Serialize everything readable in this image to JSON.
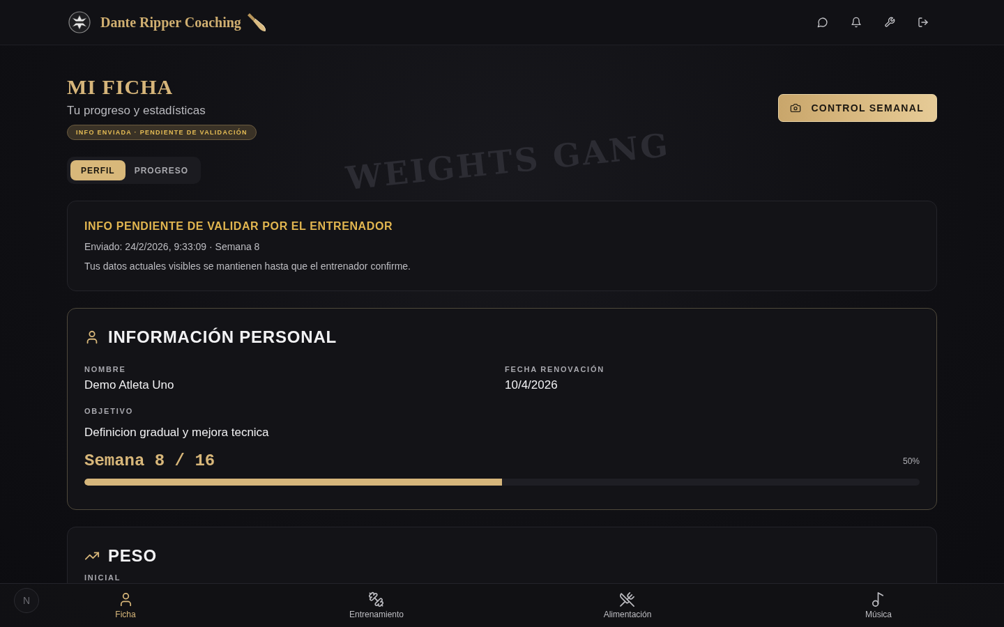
{
  "header": {
    "brand": "Dante Ripper Coaching"
  },
  "backdrop": {
    "text": "WEIGHTS GANG"
  },
  "page": {
    "title": "MI FICHA",
    "subtitle": "Tu progreso y estadísticas",
    "status_badge": "INFO ENVIADA · PENDIENTE DE VALIDACIÓN",
    "action_button": "CONTROL SEMANAL"
  },
  "tabs": [
    {
      "label": "PERFIL",
      "selected": true
    },
    {
      "label": "PROGRESO",
      "selected": false
    }
  ],
  "notice": {
    "title": "INFO PENDIENTE DE VALIDAR POR EL ENTRENADOR",
    "sent": "Enviado: 24/2/2026, 9:33:09 · Semana 8",
    "message": "Tus datos actuales visibles se mantienen hasta que el entrenador confirme."
  },
  "personal": {
    "title": "INFORMACIÓN PERSONAL",
    "fields": [
      {
        "label": "NOMBRE",
        "value": "Demo Atleta Uno"
      },
      {
        "label": "FECHA RENOVACIÓN",
        "value": "10/4/2026"
      }
    ],
    "goal": {
      "label": "OBJETIVO",
      "value": "Definicion gradual y mejora tecnica"
    },
    "week": {
      "text": "Semana 8 / 16",
      "percent": "50%",
      "level": 0.5
    }
  },
  "weight": {
    "title": "PESO",
    "fields": [
      {
        "label": "INICIAL"
      }
    ]
  },
  "dev_badge": "N",
  "bottom_nav": [
    {
      "label": "Ficha",
      "selected": true
    },
    {
      "label": "Entrenamiento",
      "selected": false
    },
    {
      "label": "Alimentación",
      "selected": false
    },
    {
      "label": "Música",
      "selected": false
    }
  ]
}
